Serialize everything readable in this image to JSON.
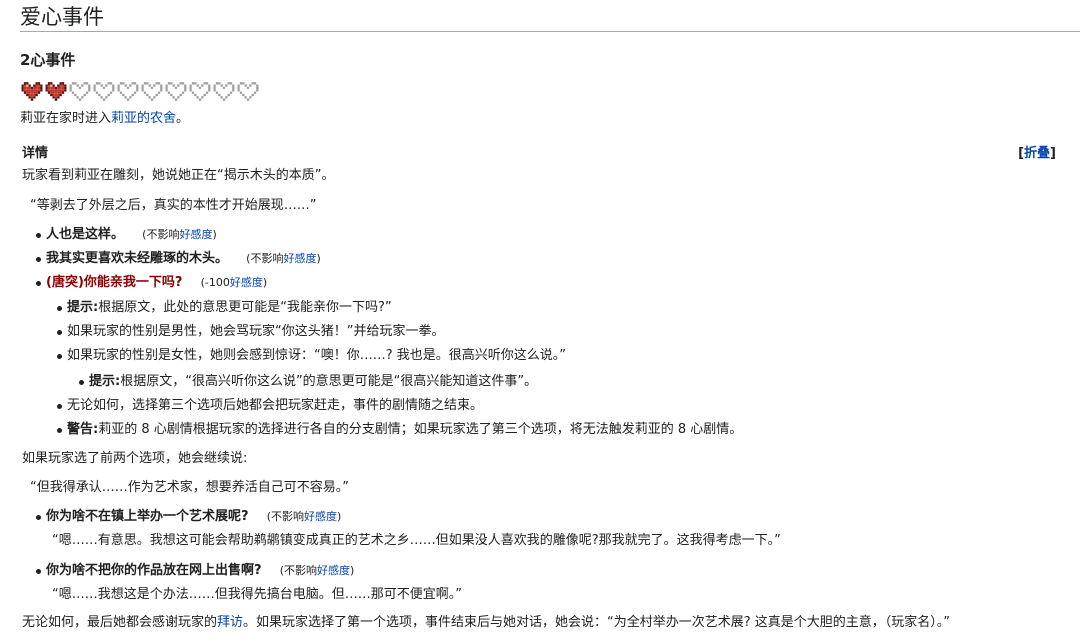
{
  "title": "爱心事件",
  "section": "2心事件",
  "hearts": {
    "filled": 2,
    "total": 10,
    "filled_color": "#c0392b",
    "empty_color": "#9e9e9e"
  },
  "location": {
    "prefix": "莉亚在家时进入",
    "link": "莉亚的农舍",
    "suffix": "。"
  },
  "details": {
    "label": "详情",
    "toggle_open": "[",
    "toggle_label": "折叠",
    "toggle_close": "]"
  },
  "intro": "玩家看到莉亚在雕刻，她说她正在“揭示木头的本质”。",
  "quote1": "“等剥去了外层之后，真实的本性才开始展现……”",
  "options1": [
    {
      "text": "人也是这样。",
      "note_prefix": "(不影响",
      "note_link": "好感度",
      "note_suffix": ")"
    },
    {
      "text": "我其实更喜欢未经雕琢的木头。",
      "note_prefix": "(不影响",
      "note_link": "好感度",
      "note_suffix": ")"
    },
    {
      "text": "(唐突)你能亲我一下吗?",
      "note_prefix": "(-100",
      "note_link": "好感度",
      "note_suffix": ")"
    }
  ],
  "sub_notes": [
    {
      "label": "提示:",
      "text": "根据原文，此处的意思更可能是“我能亲你一下吗?”"
    },
    {
      "label": "",
      "text": "如果玩家的性别是男性，她会骂玩家“你这头猪！”并给玩家一拳。"
    },
    {
      "label": "",
      "text": "如果玩家的性别是女性，她则会感到惊讶：“噢！你……? 我也是。很高兴听你这么说。”"
    },
    {
      "label": "提示:",
      "text": "根据原文，“很高兴听你这么说”的意思更可能是“很高兴能知道这件事”。"
    },
    {
      "label": "",
      "text": "无论如何，选择第三个选项后她都会把玩家赶走，事件的剧情随之结束。"
    },
    {
      "label": "警告:",
      "text": "莉亚的 8 心剧情根据玩家的选择进行各自的分支剧情；如果玩家选了第三个选项，将无法触发莉亚的 8 心剧情。"
    }
  ],
  "continue_text": "如果玩家选了前两个选项，她会继续说:",
  "quote2": "“但我得承认……作为艺术家，想要养活自己可不容易。”",
  "options2": [
    {
      "text": "你为啥不在镇上举办一个艺术展呢?",
      "note_prefix": "(不影响",
      "note_link": "好感度",
      "note_suffix": ")",
      "reply": "“嗯……有意思。我想这可能会帮助鹈鹕镇变成真正的艺术之乡……但如果没人喜欢我的雕像呢?那我就完了。这我得考虑一下。”"
    },
    {
      "text": "你为啥不把你的作品放在网上出售啊?",
      "note_prefix": "(不影响",
      "note_link": "好感度",
      "note_suffix": ")",
      "reply": "“嗯……我想这是个办法……但我得先搞台电脑。但……那可不便宜啊。”"
    }
  ],
  "final": {
    "prefix": "无论如何，最后她都会感谢玩家的",
    "link": "拜访",
    "suffix": "。如果玩家选择了第一个选项，事件结束后与她对话，她会说：“为全村举办一次艺术展? 这真是个大胆的主意，（玩家名）。”"
  }
}
